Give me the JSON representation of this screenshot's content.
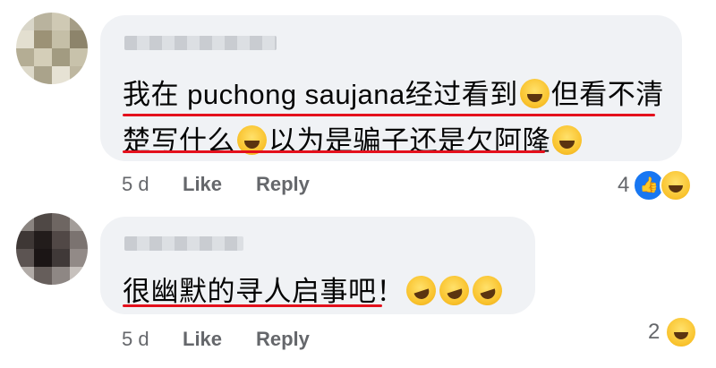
{
  "comments": [
    {
      "lines": [
        "我在 puchong saujana经过看到",
        "但看不清",
        "楚写什么",
        "以为是骗子还是欠阿隆"
      ],
      "time": "5 d",
      "like_label": "Like",
      "reply_label": "Reply",
      "reaction_count": "4",
      "reactions": [
        "like-icon",
        "haha-icon"
      ]
    },
    {
      "lines": [
        "很幽默的寻人启事吧！"
      ],
      "time": "5 d",
      "like_label": "Like",
      "reply_label": "Reply",
      "reaction_count": "2",
      "reactions": [
        "haha-icon"
      ]
    }
  ],
  "colors": {
    "bubble": "#f0f2f5",
    "underline": "#e4101c",
    "meta_text": "#65676b",
    "like_blue": "#1877f2"
  }
}
